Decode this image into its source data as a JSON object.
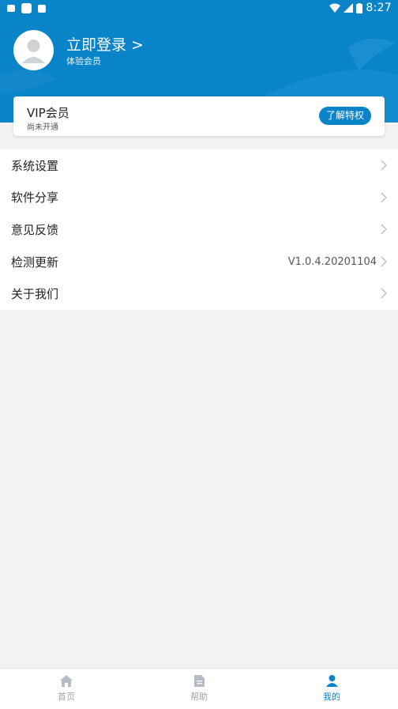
{
  "statusbar": {
    "time": "8:27"
  },
  "profile": {
    "login_label": "立即登录 >",
    "member_type": "体验会员"
  },
  "vip": {
    "title": "VIP会员",
    "status": "尚未开通",
    "button_label": "了解特权"
  },
  "menu": [
    {
      "label": "系统设置",
      "value": ""
    },
    {
      "label": "软件分享",
      "value": ""
    },
    {
      "label": "意见反馈",
      "value": ""
    },
    {
      "label": "检测更新",
      "value": "V1.0.4.20201104"
    },
    {
      "label": "关于我们",
      "value": ""
    }
  ],
  "tabs": [
    {
      "label": "首页",
      "icon": "home-icon",
      "active": false
    },
    {
      "label": "帮助",
      "icon": "document-icon",
      "active": false
    },
    {
      "label": "我的",
      "icon": "person-icon",
      "active": true
    }
  ],
  "colors": {
    "accent": "#0a84c9",
    "background": "#f2f2f2"
  }
}
